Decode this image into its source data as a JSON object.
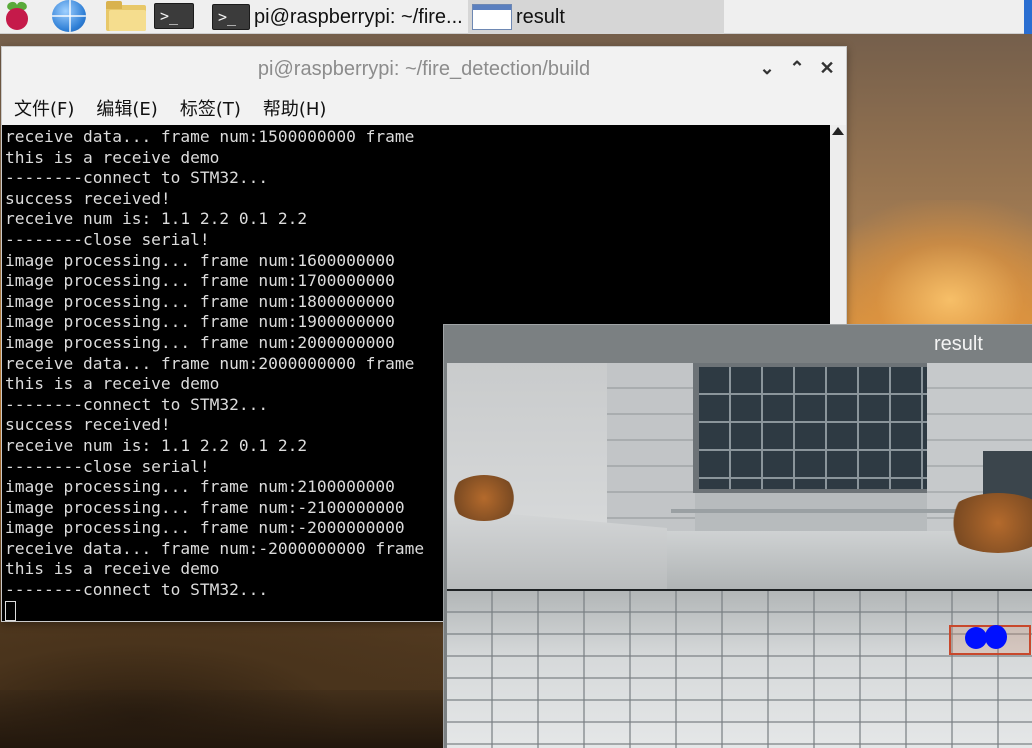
{
  "taskbar": {
    "tasks": [
      {
        "label": "pi@raspberrypi: ~/fire...",
        "icon": "terminal-icon"
      },
      {
        "label": "result",
        "icon": "window-icon"
      }
    ],
    "launchers": [
      "raspberry-pi-menu-icon",
      "web-browser-icon",
      "file-manager-icon",
      "terminal-icon"
    ]
  },
  "terminal_window": {
    "title": "pi@raspberrypi: ~/fire_detection/build",
    "controls": {
      "minimize": "⌄",
      "maximize": "⌃",
      "close": "✕"
    },
    "menu": [
      "文件(F)",
      "编辑(E)",
      "标签(T)",
      "帮助(H)"
    ],
    "lines": [
      "receive data... frame num:1500000000 frame",
      "this is a receive demo",
      "--------connect to STM32...",
      "success received!",
      "receive num is: 1.1 2.2 0.1 2.2",
      "--------close serial!",
      "image processing... frame num:1600000000",
      "image processing... frame num:1700000000",
      "image processing... frame num:1800000000",
      "image processing... frame num:1900000000",
      "image processing... frame num:2000000000",
      "receive data... frame num:2000000000 frame",
      "this is a receive demo",
      "--------connect to STM32...",
      "success received!",
      "receive num is: 1.1 2.2 0.1 2.2",
      "--------close serial!",
      "image processing... frame num:2100000000",
      "image processing... frame num:-2100000000",
      "image processing... frame num:-2000000000",
      "receive data... frame num:-2000000000 frame",
      "this is a receive demo",
      "--------connect to STM32..."
    ]
  },
  "result_window": {
    "title": "result"
  },
  "colors": {
    "terminal_bg": "#000000",
    "terminal_fg": "#dcdcdc",
    "detection_blob": "#0010ff",
    "detection_box": "#c8482c"
  }
}
